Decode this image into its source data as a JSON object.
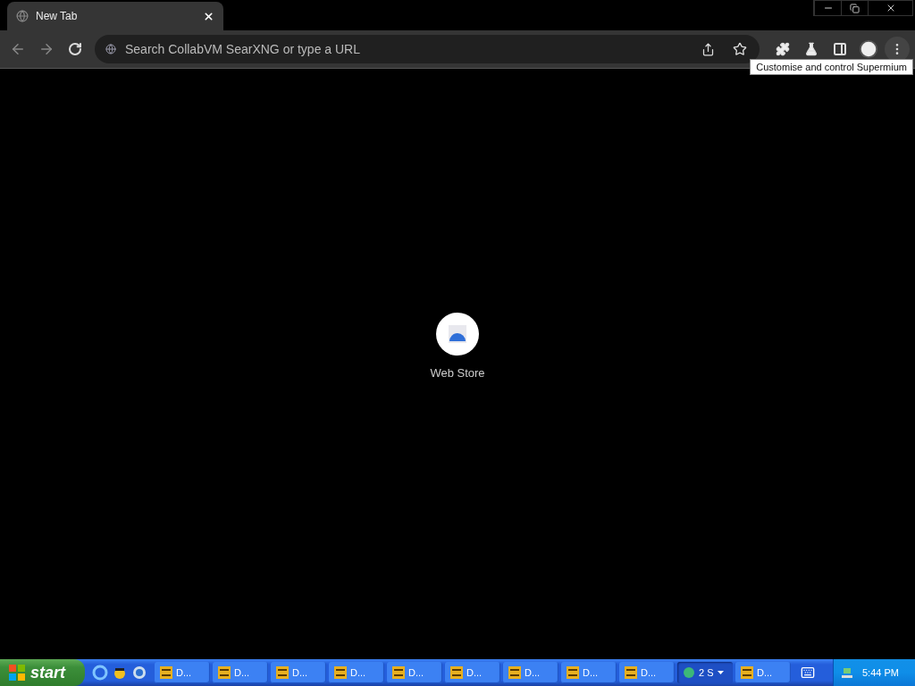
{
  "tabs": [
    {
      "title": "New Tab",
      "selected": true
    }
  ],
  "address_bar": {
    "placeholder": "Search CollabVM SearXNG or type a URL"
  },
  "tooltip": "Customise and control Supermium",
  "shortcuts": [
    {
      "label": "Web Store"
    }
  ],
  "taskbar": {
    "start": "start",
    "buttons": [
      {
        "kind": "dosbox",
        "label": "D...",
        "selected": false
      },
      {
        "kind": "dosbox",
        "label": "D...",
        "selected": false
      },
      {
        "kind": "dosbox",
        "label": "D...",
        "selected": false
      },
      {
        "kind": "dosbox",
        "label": "D...",
        "selected": false
      },
      {
        "kind": "dosbox",
        "label": "D...",
        "selected": false
      },
      {
        "kind": "dosbox",
        "label": "D...",
        "selected": false
      },
      {
        "kind": "dosbox",
        "label": "D...",
        "selected": false
      },
      {
        "kind": "dosbox",
        "label": "D...",
        "selected": false
      },
      {
        "kind": "dosbox",
        "label": "D...",
        "selected": false
      },
      {
        "kind": "group",
        "label": "2 S",
        "selected": true
      },
      {
        "kind": "dosbox",
        "label": "D...",
        "selected": false
      }
    ],
    "clock": "5:44 PM"
  }
}
